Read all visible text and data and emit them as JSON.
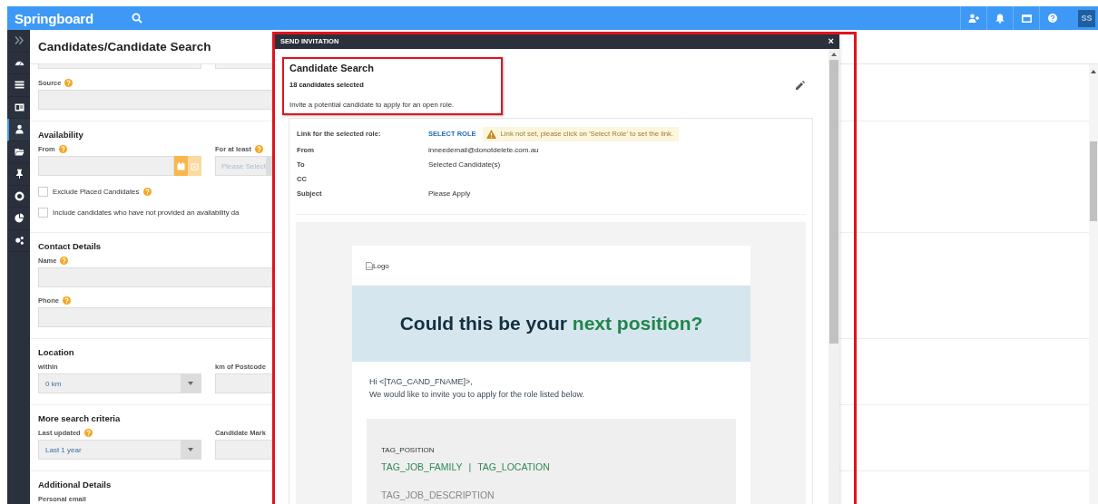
{
  "top_bar": {
    "logo": "Springboard",
    "avatar": "SS",
    "actions": [
      {
        "kind": "add-user"
      },
      {
        "kind": "bell"
      },
      {
        "kind": "window"
      },
      {
        "kind": "help"
      }
    ]
  },
  "sidebar": {
    "items": [
      {
        "kind": "expand",
        "selected": false
      },
      {
        "kind": "dashboard",
        "selected": false
      },
      {
        "kind": "list",
        "selected": false
      },
      {
        "kind": "card",
        "selected": false
      },
      {
        "kind": "person",
        "selected": true
      },
      {
        "kind": "folder",
        "selected": false
      },
      {
        "kind": "pin",
        "selected": false
      },
      {
        "kind": "target",
        "selected": false
      },
      {
        "kind": "pie",
        "selected": false
      },
      {
        "kind": "gears",
        "selected": false
      }
    ]
  },
  "page": {
    "title": "Candidates/Candidate Search"
  },
  "form": {
    "sections": [
      {
        "rows": [
          [
            {
              "kind": "text",
              "label": "Source",
              "help": true
            }
          ]
        ]
      },
      {
        "title": "Availability",
        "rows": [
          [
            {
              "kind": "date",
              "label": "From",
              "help": true
            },
            {
              "kind": "select",
              "label": "For at least",
              "help": true,
              "placeholder": "Please Select"
            }
          ],
          [
            {
              "kind": "checkbox",
              "label": "Exclude Placed Candidates",
              "help": true,
              "checked": false
            }
          ],
          [
            {
              "kind": "checkbox",
              "label": "Include candidates who have not provided an availability da",
              "checked": false
            }
          ]
        ]
      },
      {
        "title": "Contact Details",
        "rows": [
          [
            {
              "kind": "text",
              "label": "Name",
              "help": true
            }
          ],
          [
            {
              "kind": "text",
              "label": "Phone",
              "help": true
            }
          ]
        ]
      },
      {
        "title": "Location",
        "rows": [
          [
            {
              "kind": "select",
              "label": "within",
              "value": "0 km"
            },
            {
              "kind": "text",
              "label": "km of Postcode"
            }
          ]
        ]
      },
      {
        "title": "More search criteria",
        "rows": [
          [
            {
              "kind": "select",
              "label": "Last updated",
              "help": true,
              "value": "Last 1 year"
            },
            {
              "kind": "text",
              "label": "Candidate Mark"
            }
          ]
        ]
      },
      {
        "title": "Additional Details",
        "rows": [
          [
            {
              "kind": "label",
              "label": "Personal email"
            }
          ]
        ]
      }
    ]
  },
  "modal": {
    "title": "SEND INVITATION",
    "close": "×",
    "heading": "Candidate Search",
    "count": "18 candidates selected",
    "description": "Invite a potential candidate to apply for an open role.",
    "fields": [
      {
        "kind": "link",
        "label": "Link for the selected role:",
        "value": "SELECT ROLE",
        "warning": "Link not set, please click on 'Select Role' to set the link."
      },
      {
        "kind": "text",
        "label": "From",
        "value": "inneedemail@donotdelete.com.au"
      },
      {
        "kind": "text",
        "label": "To",
        "value": "Selected Candidate(s)"
      },
      {
        "kind": "text",
        "label": "CC"
      },
      {
        "kind": "text",
        "label": "Subject",
        "value": "Please Apply"
      }
    ],
    "email": {
      "logo_alt": "Logo",
      "heading": "Could this be your",
      "heading_highlight": "next position?",
      "greeting": "Hi <[TAG_CAND_FNAME]>,",
      "intro": "We would like to invite you to apply for the role listed below.",
      "role": {
        "position": "TAG_POSITION",
        "family": "TAG_JOB_FAMILY",
        "separator": "|",
        "location": "TAG_LOCATION",
        "description": "TAG_JOB_DESCRIPTION"
      }
    }
  }
}
